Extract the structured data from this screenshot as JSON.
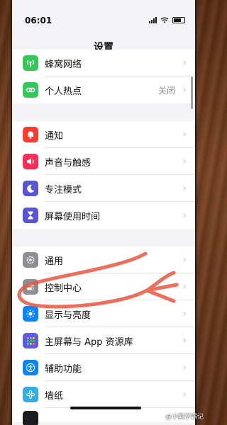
{
  "status_bar": {
    "time": "06:01"
  },
  "nav": {
    "title": "设置"
  },
  "group1": [
    {
      "label": "蜂窝网络",
      "icon": "antenna-icon",
      "color": "#34c759"
    },
    {
      "label": "个人热点",
      "value": "关闭",
      "icon": "link-icon",
      "color": "#34c759"
    }
  ],
  "group2": [
    {
      "label": "通知",
      "icon": "bell-icon",
      "color": "#ff3b30"
    },
    {
      "label": "声音与触感",
      "icon": "speaker-icon",
      "color": "#ff2d55"
    },
    {
      "label": "专注模式",
      "icon": "moon-icon",
      "color": "#5856d6"
    },
    {
      "label": "屏幕使用时间",
      "icon": "hourglass-icon",
      "color": "#5856d6"
    }
  ],
  "group3": [
    {
      "label": "通用",
      "icon": "gear-icon",
      "color": "#8e8e93"
    },
    {
      "label": "控制中心",
      "icon": "toggles-icon",
      "color": "#8e8e93"
    },
    {
      "label": "显示与亮度",
      "icon": "sun-icon",
      "color": "#0a84ff"
    },
    {
      "label": "主屏幕与 App 资源库",
      "icon": "grid-icon",
      "color": "#5e5ce6"
    },
    {
      "label": "辅助功能",
      "icon": "accessibility-icon",
      "color": "#0a84ff"
    },
    {
      "label": "墙纸",
      "icon": "flower-icon",
      "color": "#32ade6"
    }
  ],
  "watermark": "@小鹤学霸记",
  "annotation_color": "#e8563f"
}
